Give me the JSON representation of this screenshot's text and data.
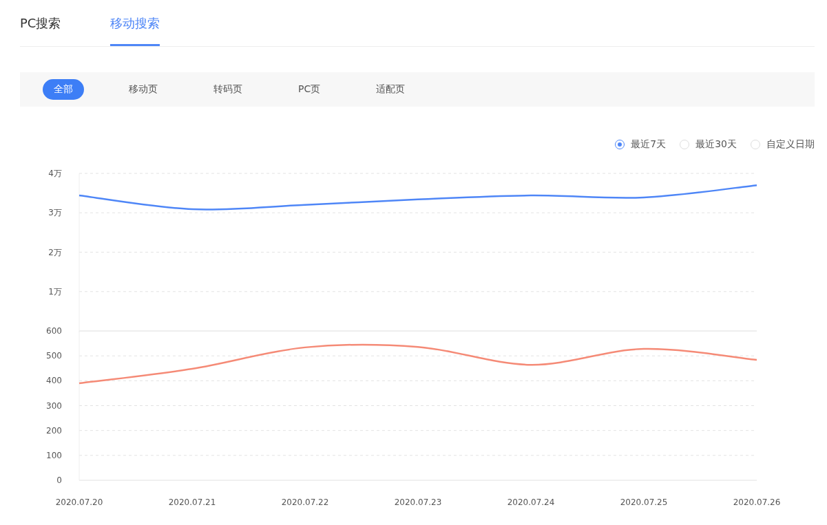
{
  "tabs": [
    {
      "label": "PC搜索",
      "selected": false
    },
    {
      "label": "移动搜索",
      "selected": true
    }
  ],
  "filters": [
    {
      "label": "全部",
      "selected": true
    },
    {
      "label": "移动页",
      "selected": false
    },
    {
      "label": "转码页",
      "selected": false
    },
    {
      "label": "PC页",
      "selected": false
    },
    {
      "label": "适配页",
      "selected": false
    }
  ],
  "ranges": [
    {
      "label": "最近7天",
      "selected": true
    },
    {
      "label": "最近30天",
      "selected": false
    },
    {
      "label": "自定义日期",
      "selected": false
    }
  ],
  "chart_top": {
    "chart_data": {
      "type": "line",
      "grid": true,
      "ylim": [
        0,
        4
      ],
      "yticks": [
        {
          "value": 1,
          "label": "1万"
        },
        {
          "value": 2,
          "label": "2万"
        },
        {
          "value": 3,
          "label": "3万"
        },
        {
          "value": 4,
          "label": "4万"
        }
      ],
      "series": [
        {
          "color": "#4e86f7",
          "values": [
            3.44,
            3.09,
            3.2,
            3.34,
            3.44,
            3.39,
            3.7
          ]
        }
      ]
    }
  },
  "chart_bottom": {
    "chart_data": {
      "type": "line",
      "categories": [
        "2020.07.20",
        "2020.07.21",
        "2020.07.22",
        "2020.07.23",
        "2020.07.24",
        "2020.07.25",
        "2020.07.26"
      ],
      "ylim": [
        0,
        600
      ],
      "grid": true,
      "yticks": [
        0,
        100,
        200,
        300,
        400,
        500,
        600
      ],
      "series": [
        {
          "color": "#f58a76",
          "values": [
            390,
            448,
            534,
            536,
            464,
            528,
            484
          ]
        }
      ]
    }
  }
}
